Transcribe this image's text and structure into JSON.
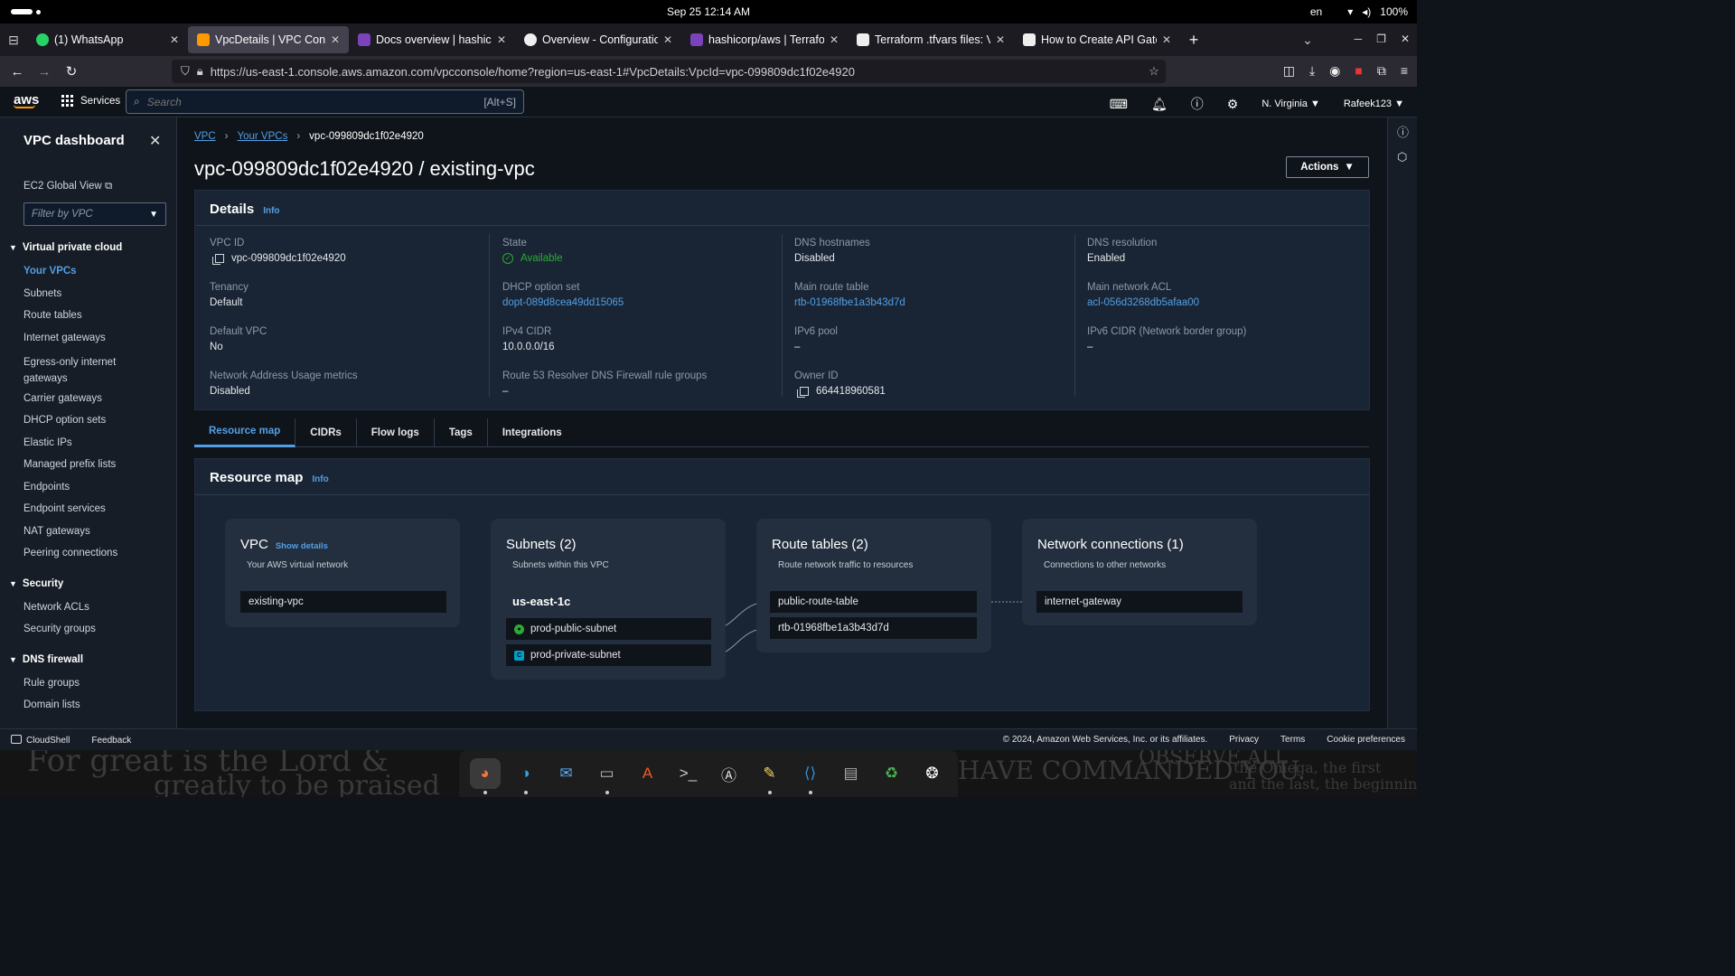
{
  "os": {
    "clock": "Sep 25  12:14 AM",
    "lang": "en",
    "battery": "100%"
  },
  "browser": {
    "tabs": [
      {
        "title": "(1) WhatsApp",
        "color": "#25d366",
        "active": false
      },
      {
        "title": "VpcDetails | VPC Console",
        "color": "#ff9900",
        "active": true
      },
      {
        "title": "Docs overview | hashicorp",
        "color": "#7b42bc",
        "active": false
      },
      {
        "title": "Overview - Configuration",
        "color": "#ffffff",
        "active": false
      },
      {
        "title": "hashicorp/aws | Terraform",
        "color": "#7b42bc",
        "active": false
      },
      {
        "title": "Terraform .tfvars files: Va",
        "color": "#ffffff",
        "active": false
      },
      {
        "title": "How to Create API Gatew",
        "color": "#ffffff",
        "active": false
      }
    ],
    "url": "https://us-east-1.console.aws.amazon.com/vpcconsole/home?region=us-east-1#VpcDetails:VpcId=vpc-099809dc1f02e4920"
  },
  "aws_header": {
    "logo": "aws",
    "services_label": "Services",
    "search_placeholder": "Search",
    "search_shortcut": "[Alt+S]",
    "region": "N. Virginia ▼",
    "account": "Rafeek123 ▼"
  },
  "sidebar": {
    "title": "VPC dashboard",
    "ec2_global_view": "EC2 Global View",
    "filter_placeholder": "Filter by VPC",
    "section_vpc": "Virtual private cloud",
    "items_vpc": [
      "Your VPCs",
      "Subnets",
      "Route tables",
      "Internet gateways",
      "Egress-only internet gateways",
      "Carrier gateways",
      "DHCP option sets",
      "Elastic IPs",
      "Managed prefix lists",
      "Endpoints",
      "Endpoint services",
      "NAT gateways",
      "Peering connections"
    ],
    "section_security": "Security",
    "items_security": [
      "Network ACLs",
      "Security groups"
    ],
    "section_dns": "DNS firewall",
    "items_dns": [
      "Rule groups",
      "Domain lists"
    ]
  },
  "breadcrumb": {
    "vpc": "VPC",
    "your_vpcs": "Your VPCs",
    "current": "vpc-099809dc1f02e4920"
  },
  "page_title": "vpc-099809dc1f02e4920 / existing-vpc",
  "actions_label": "Actions",
  "details": {
    "heading": "Details",
    "info": "Info",
    "fields": {
      "vpc_id": {
        "label": "VPC ID",
        "value": "vpc-099809dc1f02e4920"
      },
      "state": {
        "label": "State",
        "value": "Available"
      },
      "dns_hostnames": {
        "label": "DNS hostnames",
        "value": "Disabled"
      },
      "dns_resolution": {
        "label": "DNS resolution",
        "value": "Enabled"
      },
      "tenancy": {
        "label": "Tenancy",
        "value": "Default"
      },
      "dhcp": {
        "label": "DHCP option set",
        "value": "dopt-089d8cea49dd15065"
      },
      "main_rt": {
        "label": "Main route table",
        "value": "rtb-01968fbe1a3b43d7d"
      },
      "main_acl": {
        "label": "Main network ACL",
        "value": "acl-056d3268db5afaa00"
      },
      "default_vpc": {
        "label": "Default VPC",
        "value": "No"
      },
      "ipv4": {
        "label": "IPv4 CIDR",
        "value": "10.0.0.0/16"
      },
      "ipv6pool": {
        "label": "IPv6 pool",
        "value": "–"
      },
      "ipv6cidr": {
        "label": "IPv6 CIDR (Network border group)",
        "value": "–"
      },
      "nau": {
        "label": "Network Address Usage metrics",
        "value": "Disabled"
      },
      "r53": {
        "label": "Route 53 Resolver DNS Firewall rule groups",
        "value": "–"
      },
      "owner": {
        "label": "Owner ID",
        "value": "664418960581"
      }
    }
  },
  "tabs": [
    "Resource map",
    "CIDRs",
    "Flow logs",
    "Tags",
    "Integrations"
  ],
  "resource_map": {
    "heading": "Resource map",
    "info": "Info",
    "vpc_card": {
      "title": "VPC",
      "link": "Show details",
      "subtitle": "Your AWS virtual network",
      "node": "existing-vpc"
    },
    "subnets_card": {
      "title": "Subnets (2)",
      "subtitle": "Subnets within this VPC",
      "zone": "us-east-1c",
      "nodes": [
        "prod-public-subnet",
        "prod-private-subnet"
      ]
    },
    "routes_card": {
      "title": "Route tables (2)",
      "subtitle": "Route network traffic to resources",
      "nodes": [
        "public-route-table",
        "rtb-01968fbe1a3b43d7d"
      ]
    },
    "network_card": {
      "title": "Network connections (1)",
      "subtitle": "Connections to other networks",
      "nodes": [
        "internet-gateway"
      ]
    }
  },
  "footer": {
    "cloudshell": "CloudShell",
    "feedback": "Feedback",
    "copyright": "© 2024, Amazon Web Services, Inc. or its affiliates.",
    "privacy": "Privacy",
    "terms": "Terms",
    "cookies": "Cookie preferences"
  },
  "wallpaper_text": [
    "For great is the Lord &",
    "greatly to be praised",
    "HAVE COMMANDED YOU.",
    "OBSERVE ALL",
    "the Omega, the first",
    "and the last, the beginning"
  ],
  "dock": [
    "firefox-icon",
    "edge-icon",
    "thunderbird-icon",
    "files-icon",
    "app-center-icon",
    "terminal-icon",
    "software-updater-icon",
    "text-editor-icon",
    "vscode-icon",
    "disk-icon",
    "trash-icon",
    "settings-icon"
  ]
}
